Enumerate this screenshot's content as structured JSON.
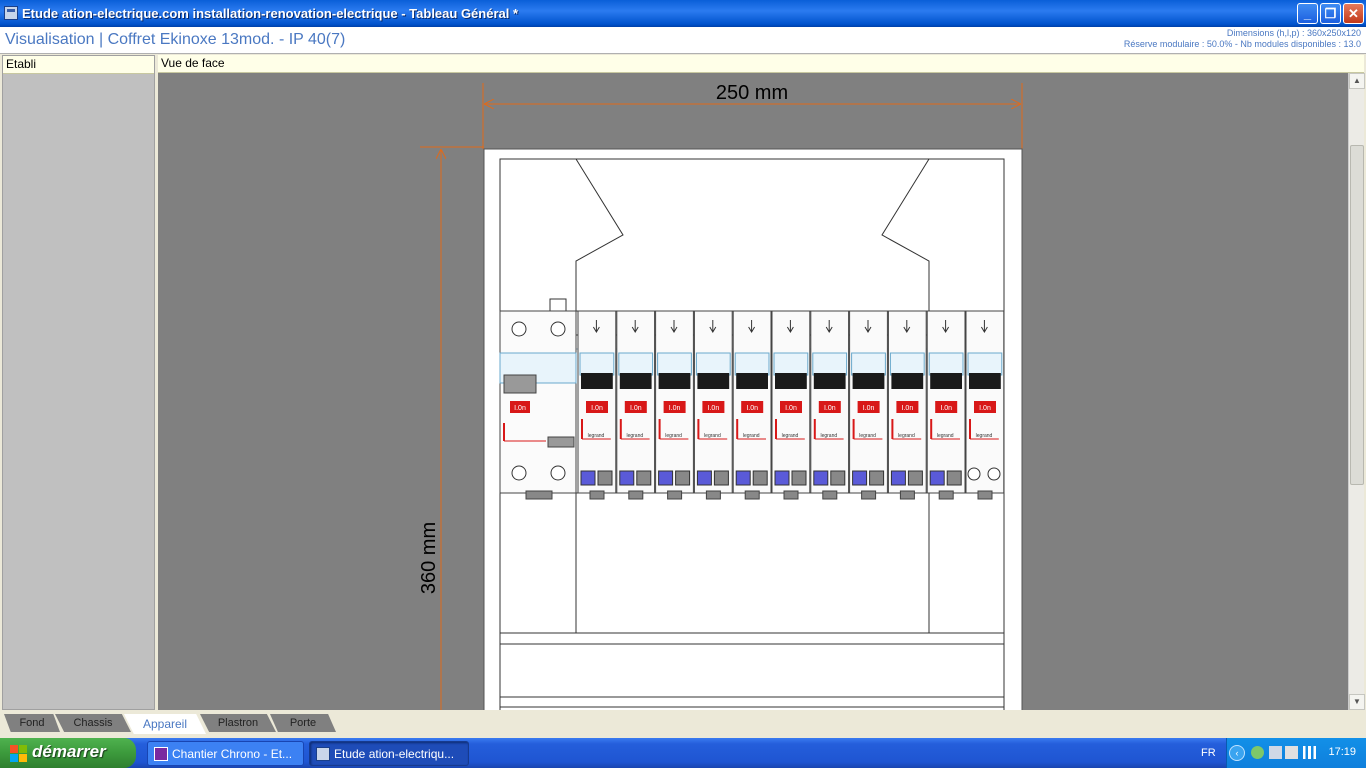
{
  "window": {
    "title": "Etude ation-electrique.com installation-renovation-electrique - Tableau Général *",
    "minimize": "_",
    "restore": "❐",
    "close": "✕"
  },
  "header": {
    "view_title": "Visualisation | Coffret Ekinoxe 13mod. - IP 40(7)",
    "dimensions": "Dimensions (h,l,p) : 360x250x120",
    "reserve": "Réserve modulaire : 50.0% - Nb modules disponibles : 13.0"
  },
  "left_panel": {
    "header": "Etabli"
  },
  "main_view": {
    "header": "Vue de face",
    "width_dimension": "250 mm",
    "height_dimension": "360 mm",
    "device_rating_label": "I.0n",
    "brand_label": "legrand",
    "breaker_count": 11
  },
  "tabs": [
    "Fond",
    "Chassis",
    "Appareil",
    "Plastron",
    "Porte"
  ],
  "active_tab": "Appareil",
  "taskbar": {
    "start_label": "démarrer",
    "tasks": [
      "Chantier Chrono - Et...",
      "Etude ation-electriqu..."
    ],
    "language": "FR",
    "clock": "17:19"
  },
  "colors": {
    "dimension_line": "#e06a1a",
    "title_blue": "#4a78c2",
    "breaker_red": "#d81818",
    "terminal_blue": "#5a5ad8"
  }
}
